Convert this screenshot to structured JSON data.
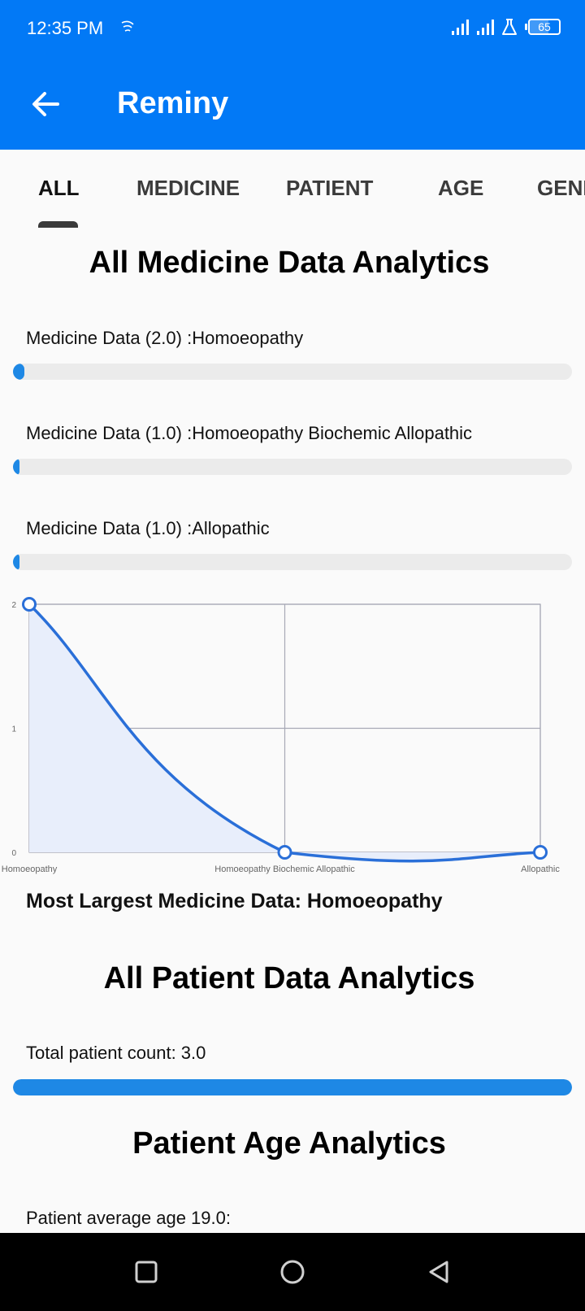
{
  "status_bar": {
    "time": "12:35 PM",
    "battery": "65",
    "battery_level": 0.65,
    "icons": [
      "cast-icon",
      "signal-icon",
      "signal-icon",
      "lab-icon",
      "battery-icon"
    ]
  },
  "app_bar": {
    "title": "Reminy",
    "back_icon": "arrow-left-icon"
  },
  "tabs": [
    {
      "label": "ALL",
      "active": true
    },
    {
      "label": "MEDICINE",
      "active": false
    },
    {
      "label": "PATIENT",
      "active": false
    },
    {
      "label": "AGE",
      "active": false
    },
    {
      "label": "GENDER",
      "active": false
    }
  ],
  "medicine_section": {
    "title": "All Medicine Data Analytics",
    "items": [
      {
        "label": "Medicine Data (2.0) :Homoeopathy",
        "level": 0.02
      },
      {
        "label": "Medicine Data (1.0) :Homoeopathy Biochemic Allopathic",
        "level": 0.01
      },
      {
        "label": "Medicine Data (1.0) :Allopathic",
        "level": 0.01
      }
    ],
    "largest": "Most Largest Medicine Data: Homoeopathy"
  },
  "chart_data": {
    "type": "line",
    "categories": [
      "Homoeopathy",
      "Homoeopathy Biochemic Allopathic",
      "Allopathic"
    ],
    "values": [
      2,
      0,
      0
    ],
    "yticks": [
      "0",
      "1",
      "2"
    ],
    "ylim": [
      0,
      2
    ],
    "grid": true,
    "curve": "smooth",
    "fill": true,
    "line_color": "#2a6fd8",
    "fill_color": "#e8eefb"
  },
  "patient_section": {
    "title": "All Patient Data Analytics",
    "label": "Total patient count: 3.0",
    "level": 1.0
  },
  "age_section": {
    "title": "Patient Age Analytics",
    "label": "Patient average age 19.0:"
  },
  "nav_bar": {
    "icons": [
      "recents-square-icon",
      "home-circle-icon",
      "back-triangle-icon"
    ]
  },
  "colors": {
    "primary": "#0279f6",
    "progress": "#1e88e5",
    "track": "#ebebeb"
  }
}
